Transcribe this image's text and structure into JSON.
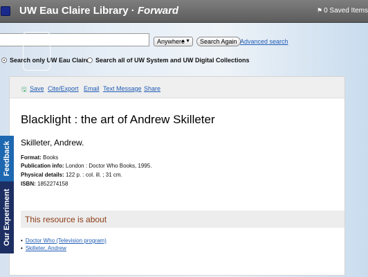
{
  "header": {
    "title": "UW Eau Claire Library",
    "separator": "·",
    "subtitle": "Forward",
    "saved_items": "0 Saved Items"
  },
  "search": {
    "query": "",
    "scope_selected": "Anywhere",
    "search_button": "Search Again",
    "advanced_link": "Advanced search",
    "radio_only": "Search only UW Eau Claire",
    "radio_all": "Search all of UW System and UW Digital Collections"
  },
  "toolbar": {
    "save": "Save",
    "cite": "Cite/Export",
    "email": "Email",
    "text": "Text Message",
    "share": "Share"
  },
  "record": {
    "title": "Blacklight : the art of Andrew Skilleter",
    "author": "Skilleter, Andrew.",
    "format_label": "Format:",
    "format": "Books",
    "pub_label": "Publication info:",
    "pub": "London : Doctor Who Books, 1995.",
    "phys_label": "Physical details:",
    "phys": "122 p. : col. ill. ; 31 cm.",
    "isbn_label": "ISBN:",
    "isbn": "1852274158"
  },
  "about": {
    "heading": "This resource is about",
    "subjects": [
      "Doctor Who (Television program)",
      "Skilleter, Andrew"
    ]
  },
  "side_tabs": {
    "feedback": "Feedback",
    "experiment": "Our Experiment"
  },
  "colors": {
    "link": "#1f5bb5",
    "about_heading": "#8a3a14",
    "feedback_tab": "#1d68b0",
    "experiment_tab": "#1d2e63"
  }
}
